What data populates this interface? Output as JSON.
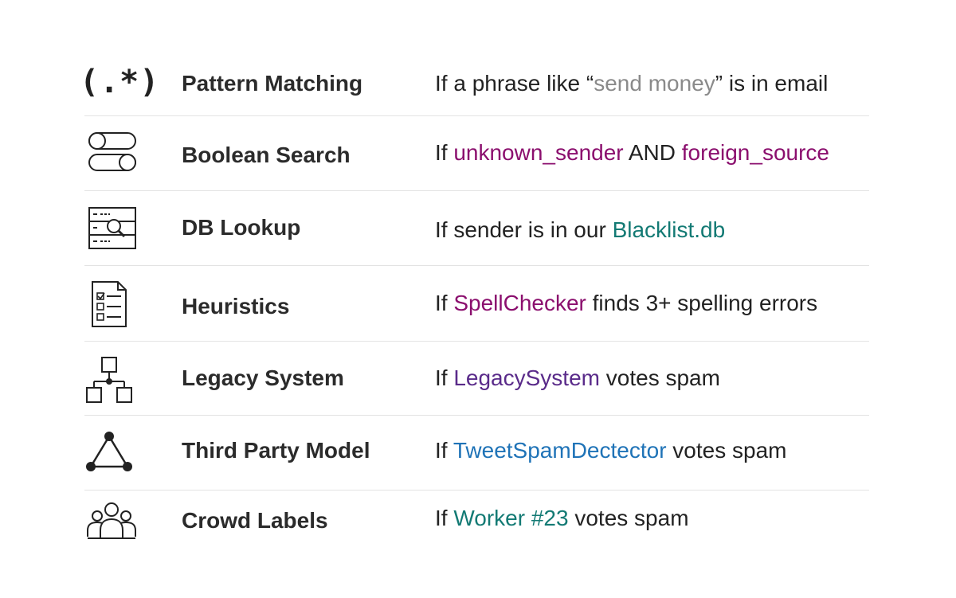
{
  "rows": [
    {
      "icon": "regex-icon",
      "icon_text": "(.*)",
      "name": "Pattern Matching",
      "rule": {
        "pre": "If a phrase like “",
        "hl": "send money",
        "post": "” is in email",
        "hl2": "",
        "post2": ""
      },
      "colors": {
        "hl": "#8a8a8a",
        "hl2": ""
      }
    },
    {
      "icon": "toggle-switches-icon",
      "name": "Boolean Search",
      "rule": {
        "pre": "If ",
        "hl": "unknown_sender",
        "post": " AND ",
        "hl2": "foreign_source",
        "post2": ""
      },
      "colors": {
        "hl": "#8b0f6e",
        "hl2": "#8b0f6e"
      }
    },
    {
      "icon": "database-search-icon",
      "name": "DB Lookup",
      "rule": {
        "pre": "If sender is in our ",
        "hl": "Blacklist.db",
        "post": "",
        "hl2": "",
        "post2": ""
      },
      "colors": {
        "hl": "#137a74",
        "hl2": ""
      }
    },
    {
      "icon": "checklist-document-icon",
      "name": "Heuristics",
      "rule": {
        "pre": "If ",
        "hl": "SpellChecker",
        "post": " finds 3+ spelling errors",
        "hl2": "",
        "post2": ""
      },
      "colors": {
        "hl": "#8b0f6e",
        "hl2": ""
      }
    },
    {
      "icon": "hierarchy-diagram-icon",
      "name": "Legacy System",
      "rule": {
        "pre": "If ",
        "hl": "LegacySystem",
        "post": " votes spam",
        "hl2": "",
        "post2": ""
      },
      "colors": {
        "hl": "#5a2b8a",
        "hl2": ""
      }
    },
    {
      "icon": "network-triangle-icon",
      "name": "Third Party Model",
      "rule": {
        "pre": "If ",
        "hl": "TweetSpamDectector",
        "post": " votes spam",
        "hl2": "",
        "post2": ""
      },
      "colors": {
        "hl": "#1f73b7",
        "hl2": ""
      }
    },
    {
      "icon": "crowd-people-icon",
      "name": "Crowd Labels",
      "rule": {
        "pre": "If ",
        "hl": "Worker #23",
        "post": " votes spam",
        "hl2": "",
        "post2": ""
      },
      "colors": {
        "hl": "#137a74",
        "hl2": ""
      }
    }
  ]
}
